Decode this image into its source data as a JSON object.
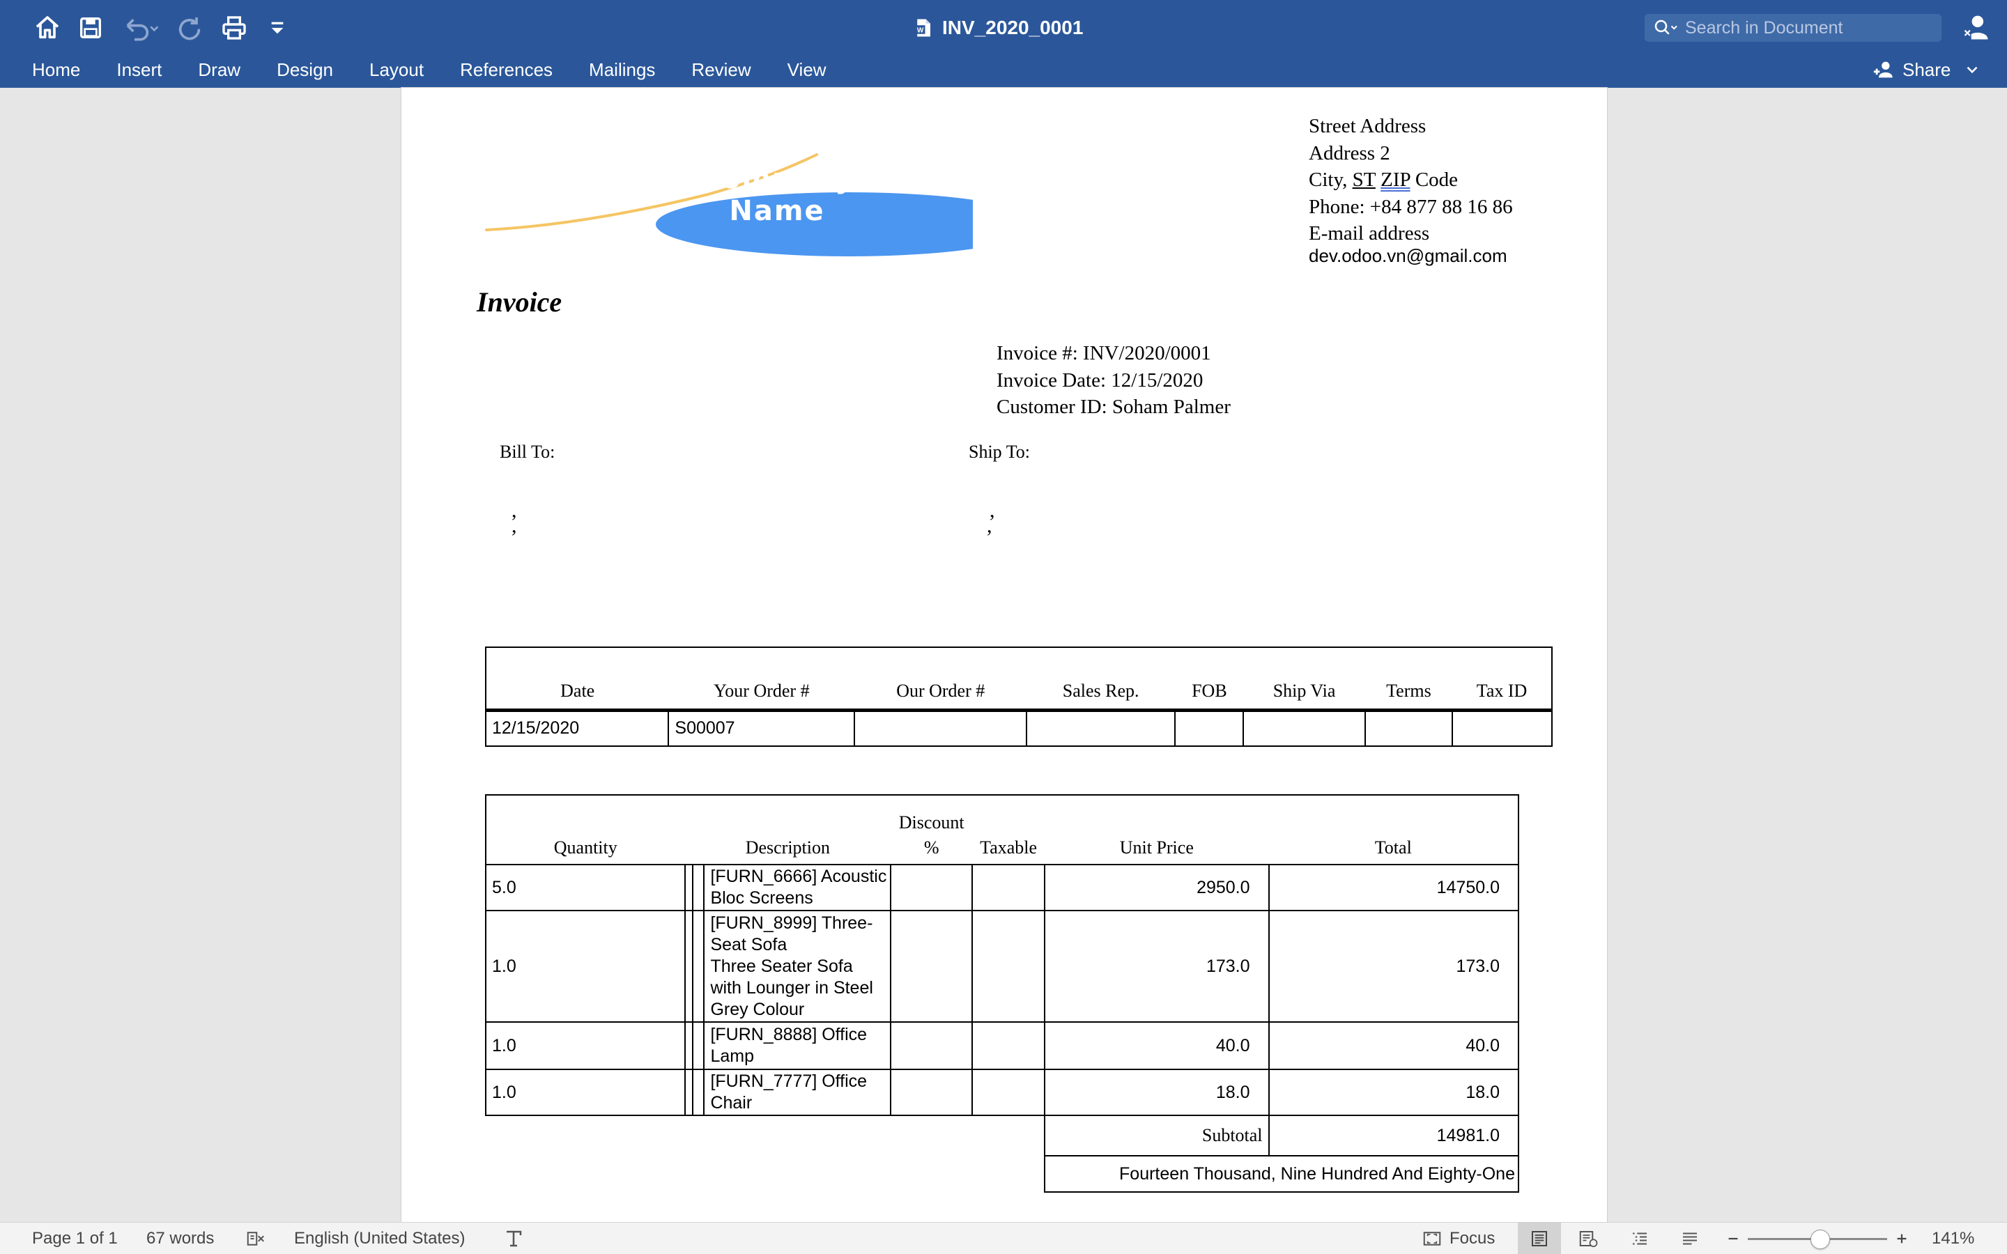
{
  "app": {
    "doc_title": "INV_2020_0001",
    "search_placeholder": "Search in Document",
    "share_label": "Share",
    "ribbon_tabs": [
      "Home",
      "Insert",
      "Draw",
      "Design",
      "Layout",
      "References",
      "Mailings",
      "Review",
      "View"
    ],
    "quick_access_icons": [
      "home-icon",
      "save-icon",
      "undo-icon",
      "redo-icon",
      "print-icon",
      "customize-icon"
    ],
    "colors": {
      "title_bar": "#2b579a",
      "logo_ellipse": "#4b96f0",
      "logo_swoosh": "#f5c564"
    }
  },
  "document": {
    "logo_text": "Company Name",
    "company_address": {
      "street": "Street Address",
      "address2": "Address 2",
      "city_prefix": "City, ",
      "st": "ST",
      "zip": "ZIP",
      "code": " Code",
      "phone": "Phone: +84 877 88 16 86",
      "email_label": "E-mail address",
      "email": "dev.odoo.vn@gmail.com"
    },
    "heading": "Invoice",
    "invoice_meta": {
      "number": "Invoice #: INV/2020/0001",
      "date": "Invoice Date: 12/15/2020",
      "customer": "Customer ID: Soham Palmer"
    },
    "bill_to_label": "Bill To:",
    "ship_to_label": "Ship To:",
    "comma": ",",
    "order_table": {
      "headers": [
        "Date",
        "Your Order #",
        "Our Order #",
        "Sales Rep.",
        "FOB",
        "Ship Via",
        "Terms",
        "Tax ID"
      ],
      "row": [
        "12/15/2020",
        "S00007",
        "",
        "",
        "",
        "",
        "",
        ""
      ]
    },
    "items_table": {
      "headers": {
        "quantity": "Quantity",
        "description": "Description",
        "discount_line1": "Discount",
        "discount_line2": "%",
        "taxable": "Taxable",
        "unit_price": "Unit Price",
        "total": "Total"
      },
      "rows": [
        {
          "quantity": "5.0",
          "description": "[FURN_6666] Acoustic Bloc Screens",
          "unit_price": "2950.0",
          "total": "14750.0"
        },
        {
          "quantity": "1.0",
          "description": "[FURN_8999] Three-Seat Sofa",
          "description_extra": "Three Seater Sofa with Lounger in Steel Grey Colour",
          "unit_price": "173.0",
          "total": "173.0"
        },
        {
          "quantity": "1.0",
          "description": "[FURN_8888] Office Lamp",
          "unit_price": "40.0",
          "total": "40.0"
        },
        {
          "quantity": "1.0",
          "description": "[FURN_7777] Office Chair",
          "unit_price": "18.0",
          "total": "18.0"
        }
      ],
      "subtotal_label": "Subtotal",
      "subtotal_value": "14981.0",
      "amount_in_words": "Fourteen Thousand, Nine Hundred And Eighty-One"
    }
  },
  "status_bar": {
    "page": "Page 1 of 1",
    "words": "67 words",
    "language": "English (United States)",
    "focus_label": "Focus",
    "zoom": "141%",
    "zoom_slider_fraction": 0.52
  }
}
